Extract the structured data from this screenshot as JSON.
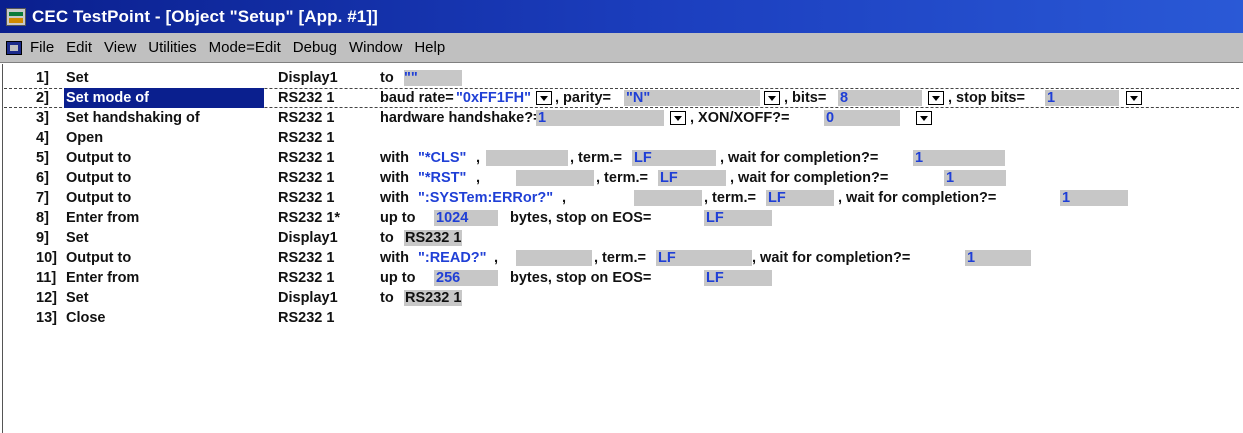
{
  "window": {
    "title": "CEC TestPoint - [Object \"Setup\" [App. #1]]"
  },
  "menu": [
    "File",
    "Edit",
    "View",
    "Utilities",
    "Mode=Edit",
    "Debug",
    "Window",
    "Help"
  ],
  "lines": {
    "l1": {
      "num": "1]",
      "cmd": "Set",
      "obj": "Display1",
      "a": "to",
      "b": "\"\""
    },
    "l2": {
      "num": "2]",
      "cmd": "Set mode of",
      "obj": "RS232 1",
      "a": "baud rate=",
      "b": "\"0xFF1FH\"",
      "c": ", parity=",
      "d": "\"N\"",
      "e": ", bits=",
      "f": "8",
      "g": ", stop bits=",
      "h": "1"
    },
    "l3": {
      "num": "3]",
      "cmd": "Set handshaking of",
      "obj": "RS232 1",
      "a": "hardware handshake?=",
      "b": "1",
      "c": ", XON/XOFF?=",
      "d": "0"
    },
    "l4": {
      "num": "4]",
      "cmd": "Open",
      "obj": "RS232 1"
    },
    "l5": {
      "num": "5]",
      "cmd": "Output to",
      "obj": "RS232 1",
      "a": "with",
      "b": "\"*CLS\"",
      "c": ",",
      "d": ", term.=",
      "e": "LF",
      "f": ", wait for completion?=",
      "g": "1"
    },
    "l6": {
      "num": "6]",
      "cmd": "Output to",
      "obj": "RS232 1",
      "a": "with",
      "b": "\"*RST\"",
      "c": ",",
      "d": ", term.=",
      "e": "LF",
      "f": ", wait for completion?=",
      "g": "1"
    },
    "l7": {
      "num": "7]",
      "cmd": "Output to",
      "obj": "RS232 1",
      "a": "with",
      "b": "\":SYSTem:ERRor?\"",
      "c": ",",
      "d": ", term.=",
      "e": "LF",
      "f": ", wait for completion?=",
      "g": "1"
    },
    "l8": {
      "num": "8]",
      "cmd": "Enter from",
      "obj": "RS232 1*",
      "a": "up to",
      "b": "1024",
      "c": "bytes, stop on EOS=",
      "d": "LF"
    },
    "l9": {
      "num": "9]",
      "cmd": "Set",
      "obj": "Display1",
      "a": "to",
      "b": "RS232 1"
    },
    "l10": {
      "num": "10]",
      "cmd": "Output to",
      "obj": "RS232 1",
      "a": "with",
      "b": "\":READ?\"",
      "c": ",",
      "d": ", term.=",
      "e": "LF",
      "f": ", wait for completion?=",
      "g": "1"
    },
    "l11": {
      "num": "11]",
      "cmd": "Enter from",
      "obj": "RS232 1",
      "a": "up to",
      "b": "256",
      "c": "bytes, stop on EOS=",
      "d": "LF"
    },
    "l12": {
      "num": "12]",
      "cmd": "Set",
      "obj": "Display1",
      "a": "to",
      "b": "RS232 1"
    },
    "l13": {
      "num": "13]",
      "cmd": "Close",
      "obj": "RS232 1"
    }
  }
}
